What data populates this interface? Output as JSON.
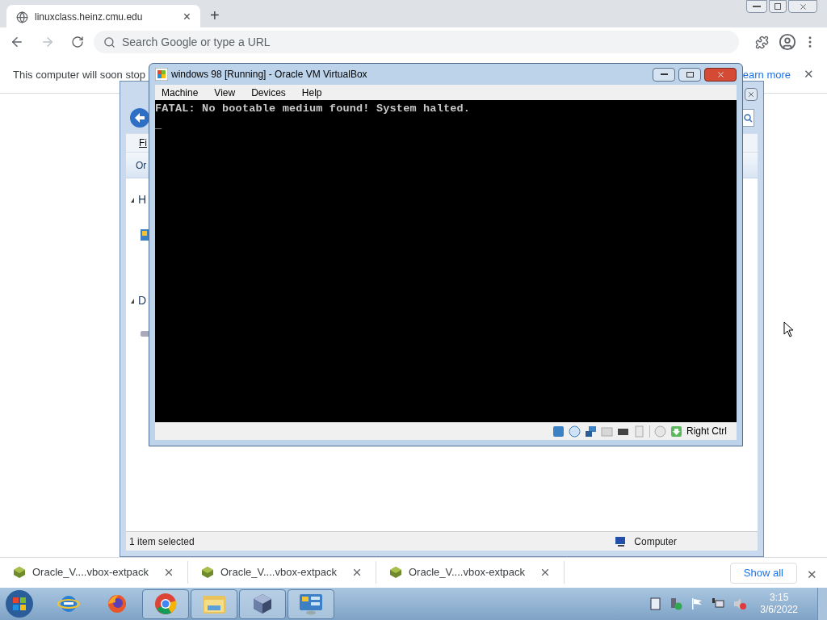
{
  "browser": {
    "tab": {
      "title": "linuxclass.heinz.cmu.edu",
      "close": "×"
    },
    "new_tab": "+",
    "omnibox": {
      "placeholder": "Search Google or type a URL"
    },
    "infobar": {
      "message": "This computer will soon stop",
      "link": "earn more",
      "close": "✕"
    },
    "downloads": [
      {
        "name": "Oracle_V....vbox-extpack"
      },
      {
        "name": "Oracle_V....vbox-extpack"
      },
      {
        "name": "Oracle_V....vbox-extpack"
      }
    ],
    "show_all": "Show all",
    "shelf_close": "✕"
  },
  "explorer": {
    "menu_fragment": "Fi",
    "command_fragment": "Or",
    "tree": [
      {
        "label": "H",
        "kind": "app"
      },
      {
        "label": "D",
        "kind": "drive"
      }
    ],
    "status": "1 item selected",
    "location": "Computer"
  },
  "virtualbox": {
    "title": "windows 98 [Running] - Oracle VM VirtualBox",
    "menu": [
      "Machine",
      "View",
      "Devices",
      "Help"
    ],
    "console": [
      "FATAL: No bootable medium found! System halted.",
      "_"
    ],
    "host_key": "Right Ctrl"
  },
  "taskbar": {
    "apps": [
      {
        "kind": "ie",
        "open": false
      },
      {
        "kind": "firefox",
        "open": false
      },
      {
        "kind": "chrome",
        "open": true
      },
      {
        "kind": "folder",
        "open": true
      },
      {
        "kind": "vbox",
        "open": true
      },
      {
        "kind": "panel",
        "open": true
      }
    ],
    "time": "3:15",
    "date": "3/6/2022"
  }
}
